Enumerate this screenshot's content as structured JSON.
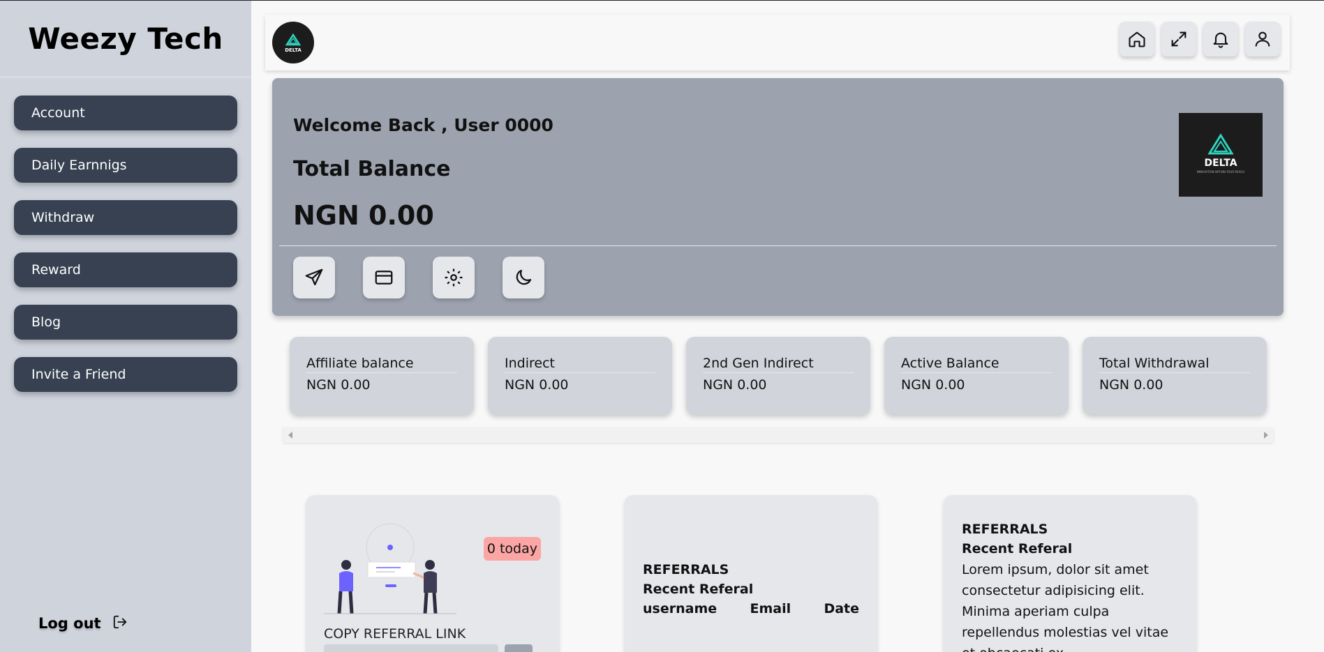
{
  "sidebar": {
    "brand": "Weezy Tech",
    "items": [
      {
        "label": "Account"
      },
      {
        "label": "Daily Earnnigs"
      },
      {
        "label": "Withdraw"
      },
      {
        "label": "Reward"
      },
      {
        "label": "Blog"
      },
      {
        "label": "Invite a Friend"
      }
    ],
    "logout_label": "Log out"
  },
  "header": {
    "logo_text": "DELTA",
    "actions": [
      "home-icon",
      "expand-icon",
      "bell-icon",
      "user-icon"
    ]
  },
  "hero": {
    "welcome": "Welcome Back , User 0000",
    "balance_label": "Total Balance",
    "balance_value": "NGN 0.00",
    "logo_text": "DELTA",
    "logo_tagline": "INNOVATION WITHIN YOUR REACH",
    "actions": [
      "send-icon",
      "card-icon",
      "settings-icon",
      "moon-icon"
    ]
  },
  "stats": [
    {
      "label": "Affiliate balance",
      "value": "NGN 0.00"
    },
    {
      "label": "Indirect",
      "value": "NGN 0.00"
    },
    {
      "label": "2nd Gen Indirect",
      "value": "NGN 0.00"
    },
    {
      "label": "Active Balance",
      "value": "NGN 0.00"
    },
    {
      "label": "Total Withdrawal",
      "value": "NGN 0.00"
    }
  ],
  "referral_card": {
    "badge": "0 today",
    "copy_label": "COPY REFERRAL LINK"
  },
  "recent_table": {
    "title": "REFERRALS",
    "subtitle": "Recent Referal",
    "columns": [
      "username",
      "Email",
      "Date"
    ]
  },
  "recent_text": {
    "title": "REFERRALS",
    "subtitle": "Recent Referal",
    "body": "Lorem ipsum, dolor sit amet consectetur adipisicing elit. Minima aperiam culpa repellendus molestias vel vitae et obcaecati ex"
  },
  "colors": {
    "sidebar_bg": "#cfd3dc",
    "nav_item_bg": "#374151",
    "hero_bg": "#9ca3af",
    "stat_bg": "#d1d5db",
    "badge_bg": "#fca5a5"
  }
}
